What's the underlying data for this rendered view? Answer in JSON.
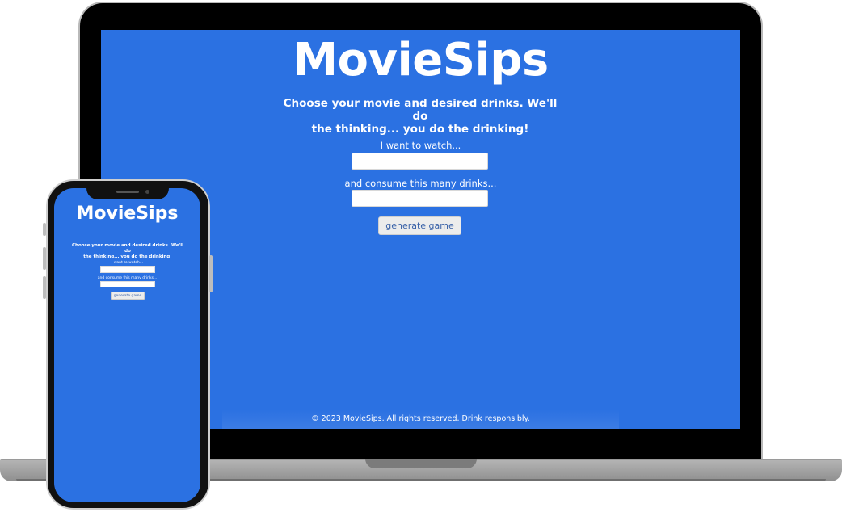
{
  "site": {
    "brand": "MovieSips",
    "tagline_line1": "Choose your movie and desired drinks. We'll do",
    "tagline_line2": "the thinking... you do the drinking!",
    "movie_label": "I want to watch...",
    "movie_value": "",
    "drinks_label": "and consume this many drinks...",
    "drinks_value": "",
    "generate_label": "generate game",
    "footer": "© 2023 MovieSips. All rights reserved. Drink responsibly."
  },
  "colors": {
    "background": "#2b71e2",
    "text": "#ffffff",
    "button_bg": "#ececec",
    "button_text": "#3a62a8"
  }
}
